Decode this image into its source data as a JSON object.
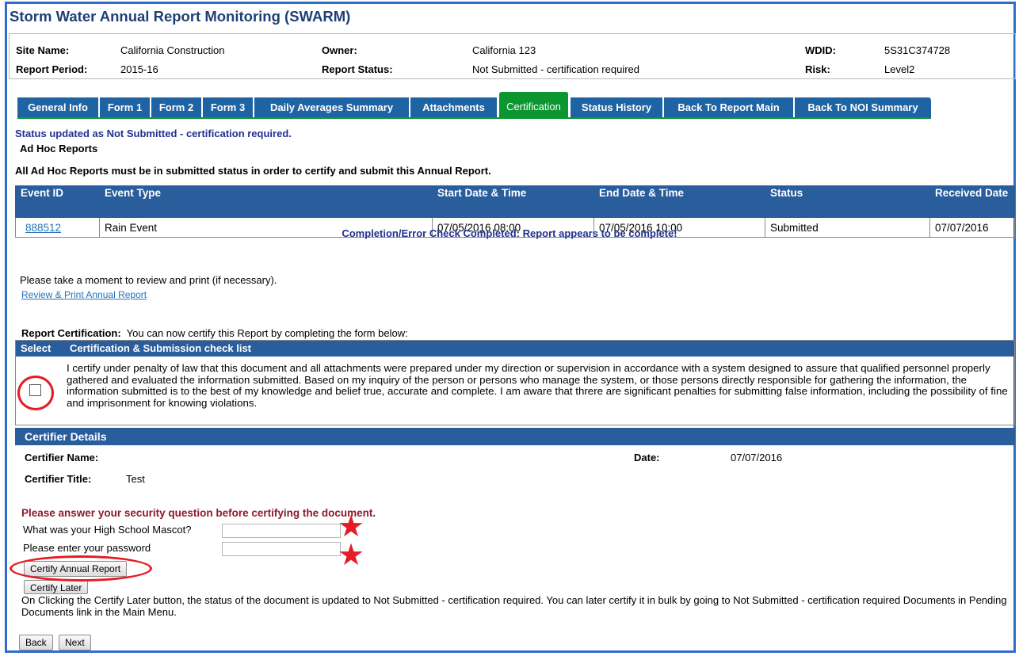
{
  "page_title": "Storm Water Annual Report Monitoring (SWARM)",
  "info": {
    "site_name_label": "Site Name:",
    "site_name": "California Construction",
    "owner_label": "Owner:",
    "owner": "California 123",
    "wdid_label": "WDID:",
    "wdid": "5S31C374728",
    "report_period_label": "Report Period:",
    "report_period": "2015-16",
    "report_status_label": "Report Status:",
    "report_status": "Not Submitted - certification required",
    "risk_label": "Risk:",
    "risk": "Level2"
  },
  "tabs": [
    {
      "label": "General Info"
    },
    {
      "label": "Form 1"
    },
    {
      "label": "Form 2"
    },
    {
      "label": "Form 3"
    },
    {
      "label": "Daily Averages Summary"
    },
    {
      "label": "Attachments"
    },
    {
      "label": "Certification",
      "active": true
    },
    {
      "label": "Status History"
    },
    {
      "label": "Back To Report Main"
    },
    {
      "label": "Back To NOI Summary"
    }
  ],
  "status_message": "Status updated as Not Submitted - certification required.",
  "adhoc": {
    "heading": "Ad Hoc Reports",
    "note": "All Ad Hoc Reports must be in submitted status in order to certify and submit this Annual Report.",
    "columns": [
      "Event ID",
      "Event Type",
      "Start Date & Time",
      "End Date & Time",
      "Status",
      "Received Date"
    ],
    "rows": [
      {
        "event_id": "888512",
        "event_type": "Rain Event",
        "start": "07/05/2016 08:00",
        "end": "07/05/2016 10:00",
        "status": "Submitted",
        "received": "07/07/2016"
      }
    ]
  },
  "completion_message": "Completion/Error Check Completed: Report appears to be complete!",
  "review": {
    "text": "Please take a moment to review and print (if necessary).",
    "link": "Review & Print Annual Report"
  },
  "certification": {
    "intro_label": "Report Certification:",
    "intro_text": "You can now certify this Report by completing the form below:",
    "col_select": "Select",
    "col_checklist": "Certification & Submission check list",
    "statement": "I certify under penalty of law that this document and all attachments were prepared under my direction or supervision in accordance with a system designed to assure that qualified personnel properly gathered and evaluated the information submitted. Based on my inquiry of the person or persons who manage the system, or those persons directly responsible for gathering the information, the information submitted is to the best of my knowledge and belief true, accurate and complete. I am aware that threre are significant penalties for submitting false information, including the possibility of fine and imprisonment for knowing violations.",
    "checked": false
  },
  "certifier": {
    "heading": "Certifier Details",
    "name_label": "Certifier Name:",
    "name": "",
    "date_label": "Date:",
    "date": "07/07/2016",
    "title_label": "Certifier Title:",
    "title": "Test"
  },
  "security": {
    "prompt": "Please answer your security question before certifying the document.",
    "question_label": "What was your High School Mascot?",
    "question_value": "",
    "password_label": "Please enter your password",
    "password_value": ""
  },
  "buttons": {
    "certify": "Certify Annual Report",
    "certify_later": "Certify Later",
    "back": "Back",
    "next": "Next"
  },
  "certify_later_note": "On Clicking the Certify Later button, the status of the document is updated to Not Submitted - certification required. You can later certify it in bulk by going to Not Submitted - certification required Documents in Pending Documents link in the Main Menu.",
  "annotation_color": "#e51c23",
  "accent_color": "#2a5d9c",
  "active_tab_color": "#0c9630"
}
